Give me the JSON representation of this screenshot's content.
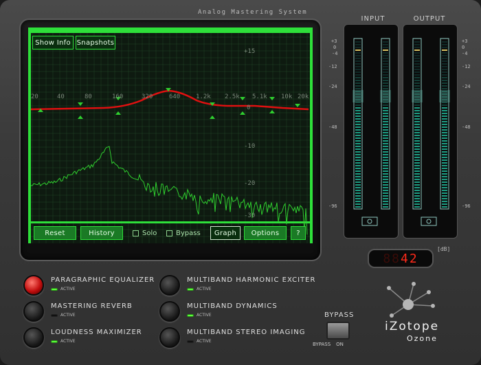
{
  "header": {
    "tagline": "Analog Mastering System"
  },
  "screen": {
    "top_buttons": {
      "show_info": "Show Info",
      "snapshots": "Snapshots"
    },
    "freq_labels": [
      "20",
      "40",
      "80",
      "160",
      "320",
      "640",
      "1.2k",
      "2.5k",
      "5.1k",
      "10k",
      "20k"
    ],
    "db_labels": [
      "+15",
      "0",
      "-10",
      "-20",
      "-30"
    ],
    "bottom_buttons": {
      "reset": "Reset",
      "history": "History",
      "solo": "Solo",
      "bypass": "Bypass",
      "graph": "Graph",
      "options": "Options",
      "help": "?"
    },
    "colors": {
      "grid": "#2e5a32",
      "eq_curve": "#e01010",
      "spectrum": "#2fcf2f",
      "accent": "#2ee03a"
    }
  },
  "meters": {
    "input_label": "INPUT",
    "output_label": "OUTPUT",
    "scale_left": [
      "+3",
      "0",
      "-4",
      "-12",
      "-24",
      "-48",
      "-96"
    ],
    "scale_right": [
      "+3",
      "0",
      "-4",
      "-12",
      "-24",
      "-48",
      "-96"
    ]
  },
  "readout": {
    "dim_digits": "88",
    "value": "42",
    "unit": "[dB]"
  },
  "modules": [
    {
      "title": "PARAGRAPHIC EQUALIZER",
      "status": "ACTIVE",
      "enabled": true,
      "selected": true
    },
    {
      "title": "MASTERING REVERB",
      "status": "ACTIVE",
      "enabled": false,
      "selected": false
    },
    {
      "title": "LOUDNESS MAXIMIZER",
      "status": "ACTIVE",
      "enabled": true,
      "selected": false
    },
    {
      "title": "MULTIBAND HARMONIC EXCITER",
      "status": "ACTIVE",
      "enabled": true,
      "selected": false
    },
    {
      "title": "MULTIBAND DYNAMICS",
      "status": "ACTIVE",
      "enabled": true,
      "selected": false
    },
    {
      "title": "MULTIBAND STEREO IMAGING",
      "status": "ACTIVE",
      "enabled": false,
      "selected": false
    }
  ],
  "bypass": {
    "title": "BYPASS",
    "opt_bypass": "BYPASS",
    "opt_on": "ON"
  },
  "brand": {
    "name": "iZotope",
    "product": "Ozone"
  }
}
